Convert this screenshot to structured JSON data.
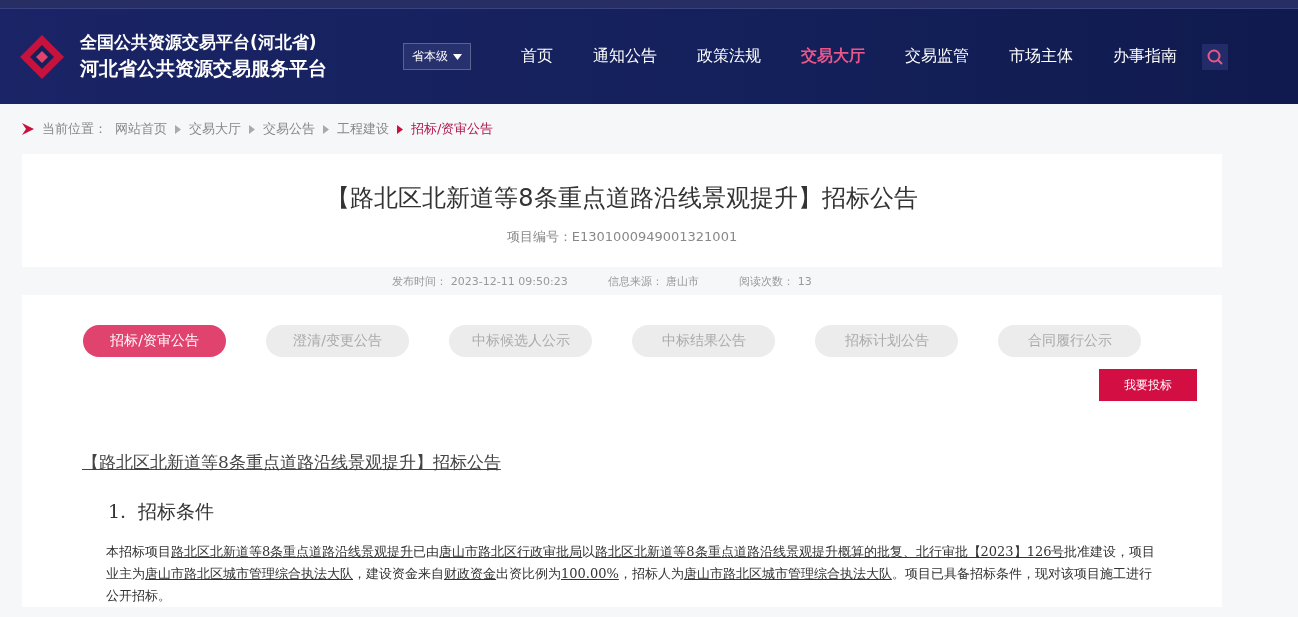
{
  "header": {
    "site_title_lines": [
      "全国公共资源交易平台(河北省)",
      "河北省公共资源交易服务平台"
    ],
    "level_select": "省本级",
    "nav": [
      {
        "label": "首页",
        "selected": false
      },
      {
        "label": "通知公告",
        "selected": false
      },
      {
        "label": "政策法规",
        "selected": false
      },
      {
        "label": "交易大厅",
        "selected": true
      },
      {
        "label": "交易监管",
        "selected": false
      },
      {
        "label": "市场主体",
        "selected": false
      },
      {
        "label": "办事指南",
        "selected": false
      }
    ]
  },
  "breadcrumb": {
    "label": "当前位置：",
    "items": [
      {
        "text": "网站首页",
        "selected": false
      },
      {
        "text": "交易大厅",
        "selected": false
      },
      {
        "text": "交易公告",
        "selected": false
      },
      {
        "text": "工程建设",
        "selected": false
      },
      {
        "text": "招标/资审公告",
        "selected": true
      }
    ]
  },
  "article": {
    "title": "【路北区北新道等8条重点道路沿线景观提升】招标公告",
    "project_no": "项目编号：E1301000949001321001",
    "meta": [
      {
        "label": "发布时间：",
        "value": "2023-12-11 09:50:23"
      },
      {
        "label": "信息来源：",
        "value": "唐山市"
      },
      {
        "label": "阅读次数：",
        "value": "13"
      }
    ],
    "tabs": [
      {
        "label": "招标/资审公告",
        "selected": true
      },
      {
        "label": "澄清/变更公告",
        "selected": false
      },
      {
        "label": "中标候选人公示",
        "selected": false
      },
      {
        "label": "中标结果公告",
        "selected": false
      },
      {
        "label": "招标计划公告",
        "selected": false
      },
      {
        "label": "合同履行公示",
        "selected": false
      }
    ],
    "bid_button": "我要投标",
    "doc_title": "【路北区北新道等8条重点道路沿线景观提升】招标公告",
    "section_heading": "1.  招标条件",
    "paragraph": [
      {
        "text": "本招标项目",
        "underlined": false
      },
      {
        "text": "路北区北新道等8条重点道路沿线景观提升",
        "underlined": true
      },
      {
        "text": "已由",
        "underlined": false
      },
      {
        "text": "唐山市路北区行政审批局",
        "underlined": true
      },
      {
        "text": "以",
        "underlined": false
      },
      {
        "text": "路北区北新道等8条重点道路沿线景观提升概算的批复、北行审批【2023】126号",
        "underlined": true
      },
      {
        "text": "批准建设，项目业主为",
        "underlined": false
      },
      {
        "text": "唐山市路北区城市管理综合执法大队",
        "underlined": true
      },
      {
        "text": "，建设资金来自",
        "underlined": false
      },
      {
        "text": "财政资金",
        "underlined": true
      },
      {
        "text": "出资比例为",
        "underlined": false
      },
      {
        "text": "100.00%",
        "underlined": true
      },
      {
        "text": "，招标人为",
        "underlined": false
      },
      {
        "text": "唐山市路北区城市管理综合执法大队",
        "underlined": true
      },
      {
        "text": "。项目已具备招标条件，现对该项目施工进行公开招标。",
        "underlined": false
      }
    ]
  }
}
